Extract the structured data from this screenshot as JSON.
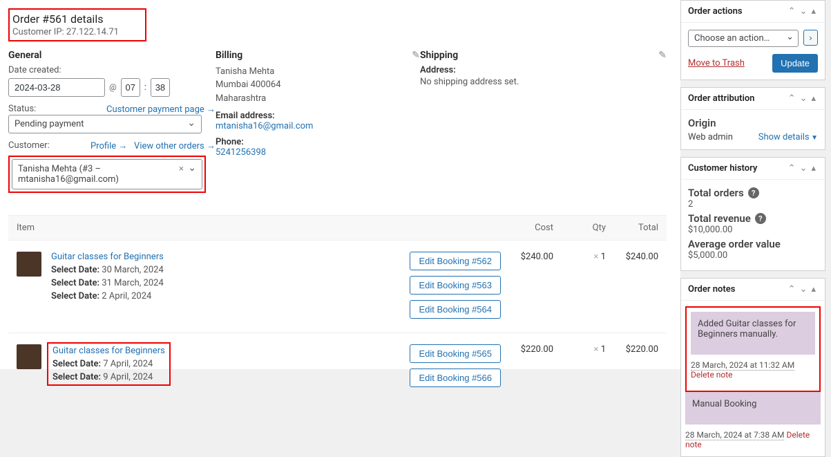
{
  "order": {
    "title": "Order #561 details",
    "ip_label": "Customer IP:",
    "ip": "27.122.14.71"
  },
  "general": {
    "heading": "General",
    "date_label": "Date created:",
    "date": "2024-03-28",
    "hour": "07",
    "minute": "38",
    "status_label": "Status:",
    "status_value": "Pending payment",
    "customer_payment_link": "Customer payment page →",
    "customer_label": "Customer:",
    "profile_link": "Profile →",
    "view_orders_link": "View other orders →",
    "customer_value": "Tanisha Mehta (#3 – mtanisha16@gmail.com)"
  },
  "billing": {
    "heading": "Billing",
    "name": "Tanisha Mehta",
    "addr1": "Mumbai 400064",
    "addr2": "Maharashtra",
    "email_label": "Email address:",
    "email": "mtanisha16@gmail.com",
    "phone_label": "Phone:",
    "phone": "5241256398"
  },
  "shipping": {
    "heading": "Shipping",
    "addr_label": "Address:",
    "none": "No shipping address set."
  },
  "columns": {
    "item": "Item",
    "cost": "Cost",
    "qty": "Qty",
    "total": "Total"
  },
  "items": [
    {
      "name": "Guitar classes for Beginners",
      "cost": "$240.00",
      "qty_prefix": "×",
      "qty": "1",
      "total": "$240.00",
      "highlight": false,
      "dates": [
        {
          "label": "Select Date:",
          "value": "30 March, 2024"
        },
        {
          "label": "Select Date:",
          "value": "31 March, 2024"
        },
        {
          "label": "Select Date:",
          "value": "2 April, 2024"
        }
      ],
      "buttons": [
        "Edit Booking #562",
        "Edit Booking #563",
        "Edit Booking #564"
      ]
    },
    {
      "name": "Guitar classes for Beginners",
      "cost": "$220.00",
      "qty_prefix": "×",
      "qty": "1",
      "total": "$220.00",
      "highlight": true,
      "dates": [
        {
          "label": "Select Date:",
          "value": "7 April, 2024"
        },
        {
          "label": "Select Date:",
          "value": "9 April, 2024"
        }
      ],
      "buttons": [
        "Edit Booking #565",
        "Edit Booking #566"
      ]
    }
  ],
  "actions": {
    "title": "Order actions",
    "select": "Choose an action…",
    "trash": "Move to Trash",
    "update": "Update"
  },
  "attribution": {
    "title": "Order attribution",
    "origin_label": "Origin",
    "origin_value": "Web admin",
    "show_details": "Show details"
  },
  "history": {
    "title": "Customer history",
    "orders_label": "Total orders",
    "orders_value": "2",
    "revenue_label": "Total revenue",
    "revenue_value": "$10,000.00",
    "avg_label": "Average order value",
    "avg_value": "$5,000.00"
  },
  "notes": {
    "title": "Order notes",
    "items": [
      {
        "text": "Added Guitar classes for Beginners manually.",
        "ts": "28 March, 2024 at 11:32 AM",
        "del": "Delete note",
        "highlight": true
      },
      {
        "text": "Manual Booking",
        "ts": "28 March, 2024 at 7:38 AM",
        "del": "Delete note",
        "highlight": false
      }
    ]
  }
}
